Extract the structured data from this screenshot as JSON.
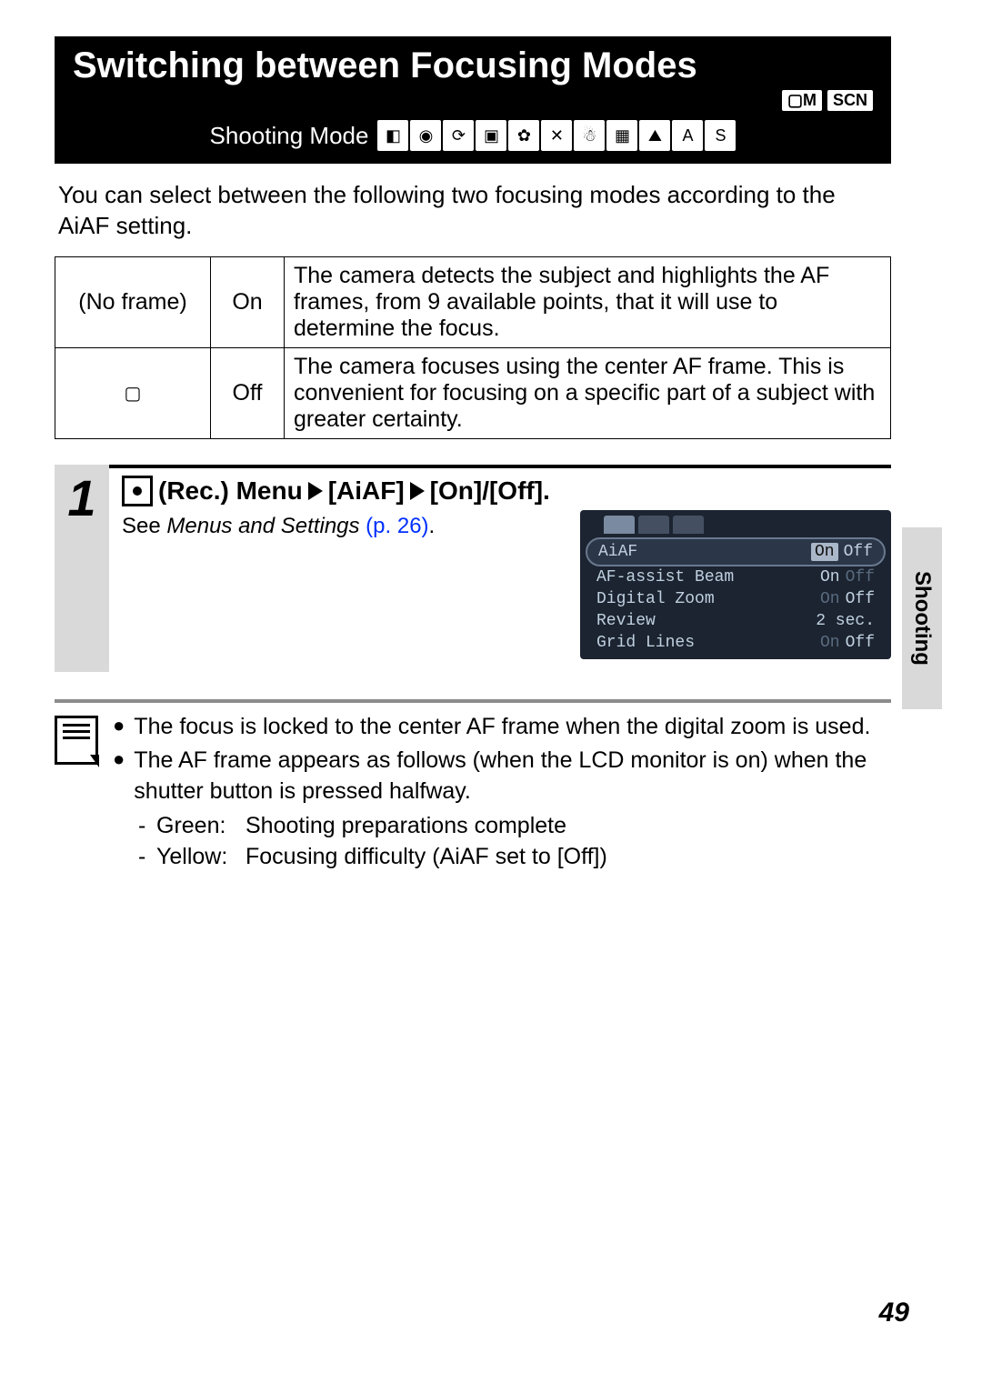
{
  "header": {
    "title": "Switching between Focusing Modes",
    "corner_badges": [
      "▢M",
      "SCN"
    ],
    "shooting_label": "Shooting Mode",
    "mode_icons": [
      "◧",
      "◉",
      "⟳",
      "▣",
      "✿",
      "✕",
      "☃",
      "▦",
      "⛰",
      "A",
      "S"
    ]
  },
  "intro": "You can select between the following two focusing modes according to the AiAF setting.",
  "table": {
    "rows": [
      {
        "frame": "(No frame)",
        "state": "On",
        "desc": "The camera detects the subject and highlights the AF frames, from 9 available points, that it will use to determine the focus."
      },
      {
        "frame": "▢",
        "state": "Off",
        "desc": "The camera focuses using the center AF frame. This is convenient for focusing on a specific part of a subject with greater certainty."
      }
    ]
  },
  "step": {
    "number": "1",
    "parts": {
      "rec": "(Rec.) Menu",
      "aiaf": "[AiAF]",
      "onoff": "[On]/[Off]."
    },
    "see_prefix": "See ",
    "see_italic": "Menus and Settings",
    "see_link": " (p. 26)",
    "see_suffix": "."
  },
  "lcd": {
    "rows": [
      {
        "label": "AiAF",
        "values": [
          "On",
          "Off"
        ],
        "sel": 0,
        "hl": true
      },
      {
        "label": "AF-assist Beam",
        "values": [
          "On",
          "Off"
        ],
        "sel": 0
      },
      {
        "label": "Digital Zoom",
        "values": [
          "On",
          "Off"
        ],
        "sel": 1
      },
      {
        "label": "Review",
        "values": [
          "2 sec."
        ],
        "sel": 0
      },
      {
        "label": "Grid Lines",
        "values": [
          "On",
          "Off"
        ],
        "sel": 1
      }
    ]
  },
  "notes": {
    "items": [
      "The focus is locked to the center AF frame when the digital zoom is used.",
      "The AF frame appears as follows (when the LCD monitor is on) when the shutter button is pressed halfway."
    ],
    "subs": [
      {
        "dash": "-",
        "label": "Green:",
        "text": "Shooting preparations complete"
      },
      {
        "dash": "-",
        "label": "Yellow:",
        "text": "Focusing difficulty (AiAF set to [Off])"
      }
    ]
  },
  "side_tab": "Shooting",
  "page_number": "49"
}
